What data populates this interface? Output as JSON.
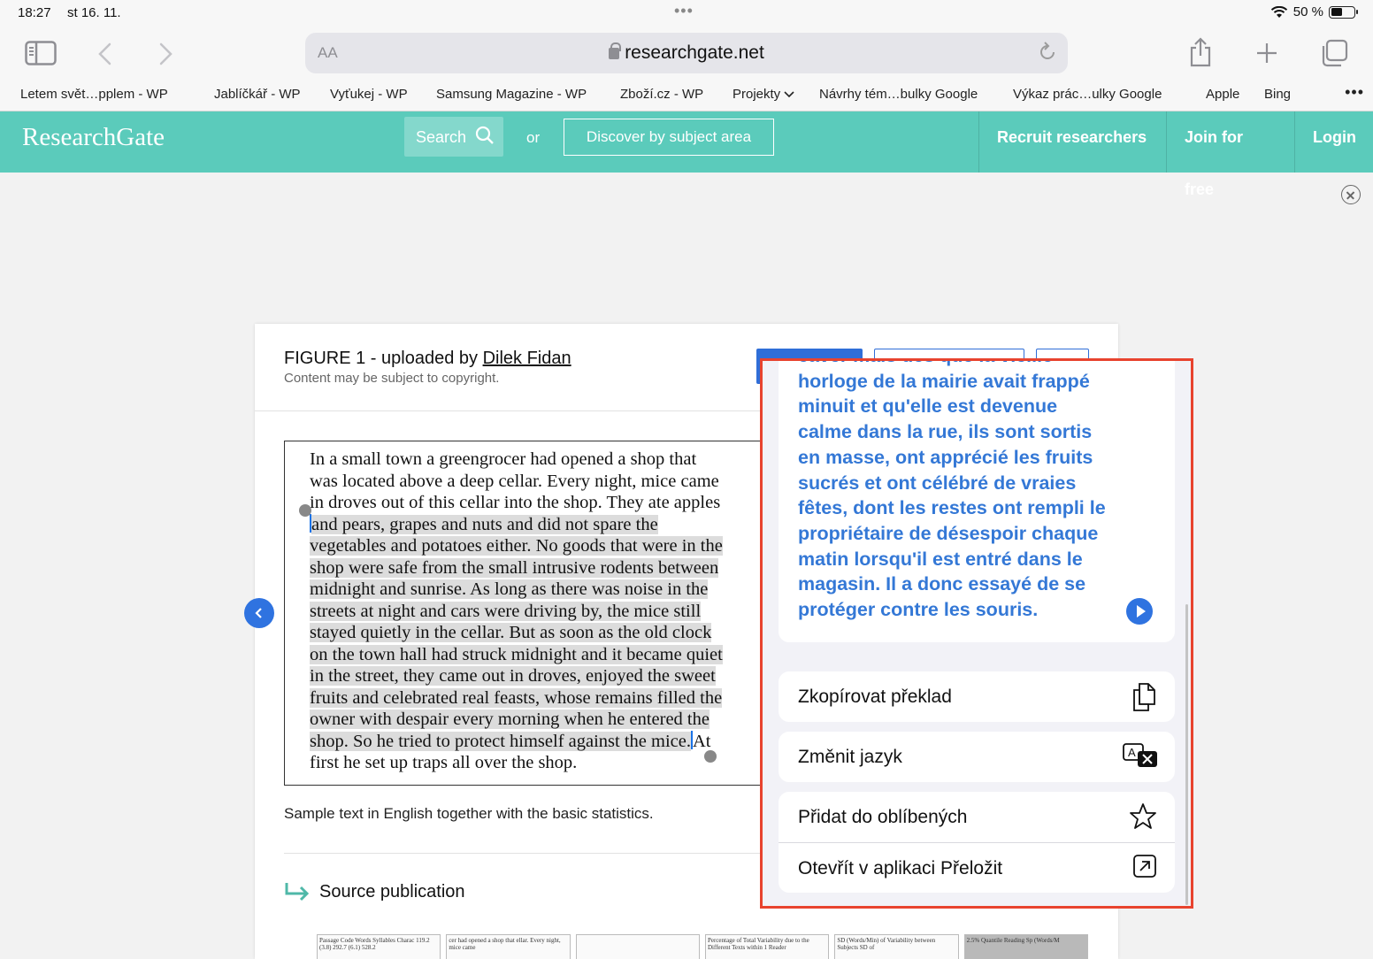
{
  "status": {
    "time": "18:27",
    "date": "st 16. 11.",
    "battery": "50 %",
    "battery_level": 0.5
  },
  "browser": {
    "aa_label": "AA",
    "url": "researchgate.net"
  },
  "bookmarks": [
    "Letem svět…pplem - WP",
    "Jablíčkář - WP",
    "Vyťukej - WP",
    "Samsung Magazine - WP",
    "Zboží.cz - WP",
    "Projekty",
    "Návrhy tém…bulky Google",
    "Výkaz prác…ulky Google",
    "Apple",
    "Bing"
  ],
  "rg": {
    "logo": "ResearchGate",
    "search_label": "Search",
    "or": "or",
    "discover": "Discover by subject area",
    "nav": [
      "Recruit researchers",
      "Join for free",
      "Login"
    ]
  },
  "figure": {
    "title_prefix": "FIGURE 1 - uploaded by ",
    "author": "Dilek Fidan",
    "copyright": "Content may be subject to copyright.",
    "caption": "Sample text in English together with the basic statistics.",
    "source_label": "Source publication",
    "scan_lines": [
      "In a small town a greengrocer had opened a shop that",
      "was located above a deep cellar. Every night, mice came",
      "in droves out of this cellar into the shop. They ate apples",
      "and pears, grapes and nuts and did not spare the",
      "vegetables and potatoes either. No goods that were in the",
      "shop were safe from the small intrusive rodents between",
      "midnight and sunrise. As long as there was noise in the",
      "streets at night and cars were driving by, the mice still",
      "stayed quietly in the cellar. But as soon as the old clock",
      "on the town hall had struck midnight and it became quiet",
      "in the street, they came out in droves, enjoyed the sweet",
      "fruits and celebrated real feasts, whose remains filled the",
      "owner with despair every morning when he entered the",
      "shop. So he tried to protect himself against the mice.",
      "first he set up traps all over the shop."
    ],
    "scan_line14_tail": "At",
    "thumbs": [
      "Passage Code  Words  Syllables  Charac  119.2 (3.8)  292.7 (6.1)  528.2",
      "cer had opened a shop that ellar. Every night, mice came",
      "",
      "Percentage of Total Variability due to the Different Texts within 1 Reader",
      "SD (Words/Min) of Variability between Subjects  SD of",
      "2.5% Quantile Reading Sp (Words/M"
    ]
  },
  "translate": {
    "lines": [
      "caver mais dès que la vieille",
      "horloge de la mairie avait frappé",
      "minuit et qu'elle est devenue",
      "calme dans la rue, ils sont sortis",
      "en masse, ont apprécié les fruits",
      "sucrés et ont célébré de vraies",
      "fêtes, dont les restes ont rempli le",
      "propriétaire de désespoir chaque",
      "matin lorsqu'il est entré dans le",
      "magasin. Il a donc essayé de se",
      "protéger contre les souris."
    ],
    "actions": {
      "copy": "Zkopírovat překlad",
      "change_language": "Změnit jazyk",
      "favorite": "Přidat do oblíbených",
      "open_app": "Otevřít v aplikaci Přeložit"
    }
  }
}
